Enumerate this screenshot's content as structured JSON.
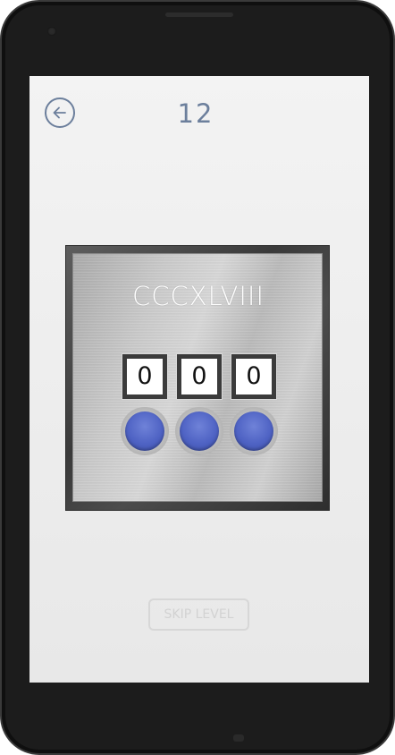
{
  "header": {
    "back_icon": "arrow-left-circle-icon",
    "level": "12"
  },
  "puzzle": {
    "numeral": "CCCXLVIII",
    "digits": [
      "0",
      "0",
      "0"
    ],
    "button_color": "#4f63c4"
  },
  "footer": {
    "skip_label": "SKIP LEVEL"
  },
  "colors": {
    "accent": "#6c7f9c",
    "screen_bg": "#eeeeee"
  }
}
